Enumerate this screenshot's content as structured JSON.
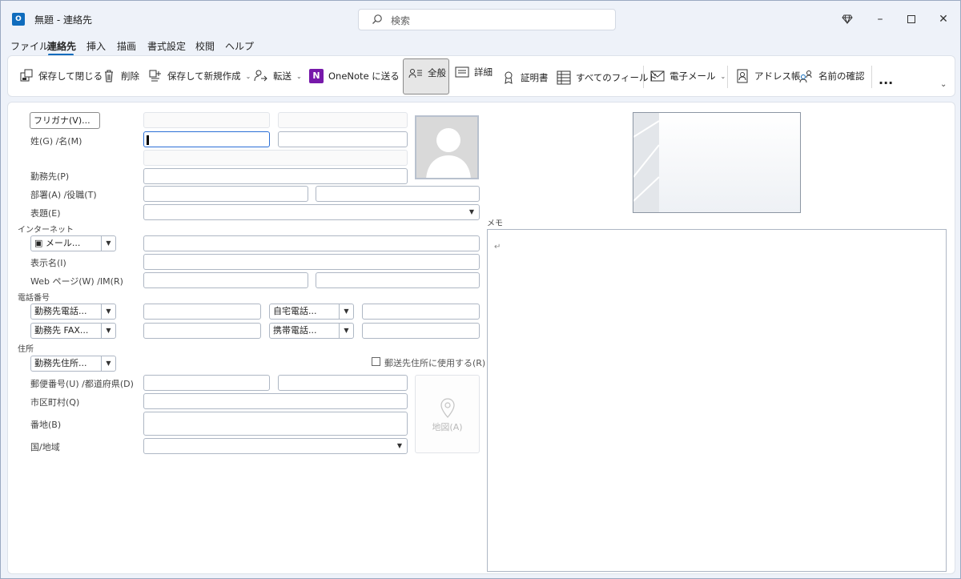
{
  "window": {
    "title": "無題 - 連絡先",
    "app_icon": "outlook-icon"
  },
  "search": {
    "placeholder": "検索"
  },
  "menu": [
    {
      "label": "ファイル"
    },
    {
      "label": "連絡先",
      "active": true
    },
    {
      "label": "挿入"
    },
    {
      "label": "描画"
    },
    {
      "label": "書式設定"
    },
    {
      "label": "校閲"
    },
    {
      "label": "ヘルプ"
    }
  ],
  "ribbon": {
    "save_close": "保存して閉じる",
    "delete": "削除",
    "save_new": "保存して新規作成",
    "forward": "転送",
    "onenote": "OneNote に送る",
    "general": "全般",
    "details": "詳細",
    "certificates": "証明書",
    "all_fields": "すべてのフィールド",
    "email": "電子メール",
    "address_book": "アドレス帳",
    "check_names": "名前の確認",
    "more": "..."
  },
  "form": {
    "furigana_button": "フリガナ(V)...",
    "name_label": "姓(G)  /名(M)",
    "company_label": "勤務先(P)",
    "dept_label": "部署(A)  /役職(T)",
    "file_as_label": "表題(E)",
    "internet_section": "インターネット",
    "email_dropdown": "メール...",
    "display_name_label": "表示名(I)",
    "web_label": "Web ページ(W)  /IM(R)",
    "phone_section": "電話番号",
    "phone1": "勤務先電話...",
    "phone2": "自宅電話...",
    "phone3": "勤務先 FAX...",
    "phone4": "携帯電話...",
    "address_section": "住所",
    "address_dropdown": "勤務先住所...",
    "mailing_checkbox": "郵送先住所に使用する(R)",
    "mailing_checked": false,
    "postal_label": "郵便番号(U)  /都道府県(D)",
    "city_label": "市区町村(Q)",
    "street_label": "番地(B)",
    "country_label": "国/地域",
    "map_button": "地図(A)",
    "memo_label": "メモ",
    "memo_mark": "↵"
  },
  "colors": {
    "accent": "#0f6cbd",
    "onenote": "#7719aa",
    "window_bg": "#eef2f9"
  }
}
